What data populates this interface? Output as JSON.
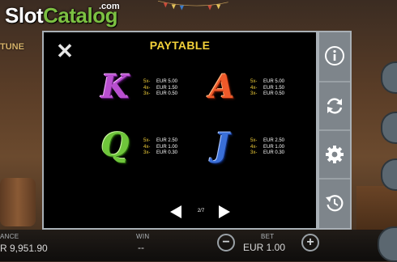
{
  "logo": {
    "slot": "Slot",
    "catalog": "Catalog",
    "com": ".com"
  },
  "game_title_fragment": "TUNE",
  "paytable": {
    "title": "PAYTABLE",
    "symbols": [
      {
        "glyph": "K",
        "pays": [
          {
            "mult": "5x-",
            "amount": "EUR 5.00"
          },
          {
            "mult": "4x-",
            "amount": "EUR 1.50"
          },
          {
            "mult": "3x-",
            "amount": "EUR 0.50"
          }
        ]
      },
      {
        "glyph": "A",
        "pays": [
          {
            "mult": "5x-",
            "amount": "EUR 5.00"
          },
          {
            "mult": "4x-",
            "amount": "EUR 1.50"
          },
          {
            "mult": "3x-",
            "amount": "EUR 0.50"
          }
        ]
      },
      {
        "glyph": "Q",
        "pays": [
          {
            "mult": "5x-",
            "amount": "EUR 2.50"
          },
          {
            "mult": "4x-",
            "amount": "EUR 1.00"
          },
          {
            "mult": "3x-",
            "amount": "EUR 0.30"
          }
        ]
      },
      {
        "glyph": "J",
        "pays": [
          {
            "mult": "5x-",
            "amount": "EUR 2.50"
          },
          {
            "mult": "4x-",
            "amount": "EUR 1.00"
          },
          {
            "mult": "3x-",
            "amount": "EUR 0.30"
          }
        ]
      }
    ],
    "page_indicator": "2/7"
  },
  "side_menu": {
    "icons": [
      "info-icon",
      "refresh-icon",
      "settings-gear-icon",
      "history-icon"
    ]
  },
  "bottom_bar": {
    "balance_label": "ANCE",
    "balance_value": "R 9,951.90",
    "win_label": "WIN",
    "win_value": "--",
    "bet_label": "BET",
    "bet_value": "EUR 1.00",
    "minus": "−",
    "plus": "+"
  },
  "colors": {
    "title_yellow": "#f4d23a",
    "panel_bg": "#000000",
    "side_bg": "#7e858b",
    "k_purple": "#b94fd0",
    "a_orange": "#ef5a2a",
    "q_green": "#6fc53b",
    "j_blue": "#3a6fd8",
    "logo_green": "#7cc042"
  }
}
